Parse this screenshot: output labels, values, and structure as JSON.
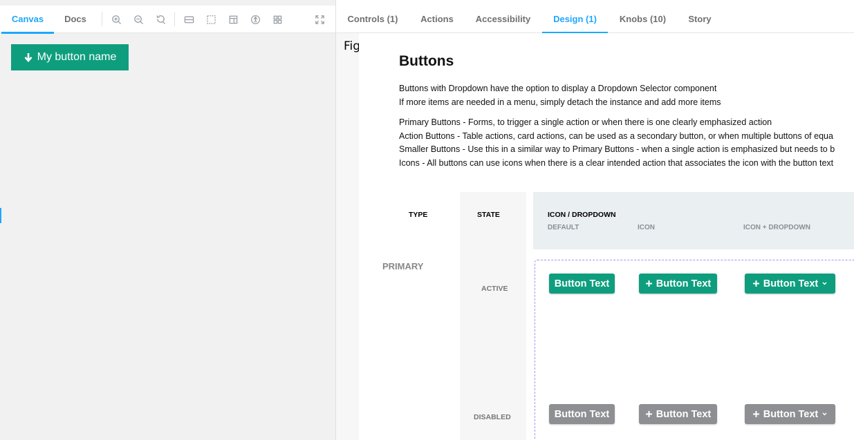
{
  "left_toolbar": {
    "tabs": [
      {
        "label": "Canvas",
        "active": true
      },
      {
        "label": "Docs",
        "active": false
      }
    ],
    "icons": [
      "zoom-in-icon",
      "zoom-out-icon",
      "zoom-reset-icon",
      "background-icon",
      "grid-icon",
      "viewport-icon",
      "accessibility-icon",
      "outline-icon",
      "fullscreen-icon"
    ]
  },
  "preview": {
    "button_label": "My button name",
    "button_icon": "arrow-down-icon",
    "button_color": "#0e9e7e"
  },
  "addon_tabs": [
    {
      "label": "Controls (1)",
      "active": false
    },
    {
      "label": "Actions",
      "active": false
    },
    {
      "label": "Accessibility",
      "active": false
    },
    {
      "label": "Design (1)",
      "active": true
    },
    {
      "label": "Knobs (10)",
      "active": false
    },
    {
      "label": "Story",
      "active": false
    }
  ],
  "design": {
    "frame_label": "Figma",
    "title": "Buttons",
    "paragraph1": [
      "Buttons with Dropdown have the option to display a Dropdown Selector component",
      "If more items are needed in a menu, simply detach the instance and add more items"
    ],
    "paragraph2": [
      "Primary Buttons - Forms, to trigger a single action or when there is one clearly emphasized action",
      "Action Buttons - Table actions, card actions, can be used as a secondary button, or when multiple buttons of equa",
      "Smaller Buttons -  Use this in a similar way to Primary Buttons - when a single action is emphasized but needs to b",
      "Icons - All buttons can use icons when there is a clear intended action that associates the icon with the button text"
    ],
    "table": {
      "type_header": "TYPE",
      "state_header": "STATE",
      "icon_header": "ICON / DROPDOWN",
      "sub_headers": [
        "DEFAULT",
        "ICON",
        "ICON + DROPDOWN"
      ],
      "type_primary": "PRIMARY",
      "states": [
        "ACTIVE",
        "DISABLED"
      ],
      "button_text": "Button Text",
      "active_color": "#0e9e7e",
      "disabled_color": "#8d8f92"
    }
  }
}
